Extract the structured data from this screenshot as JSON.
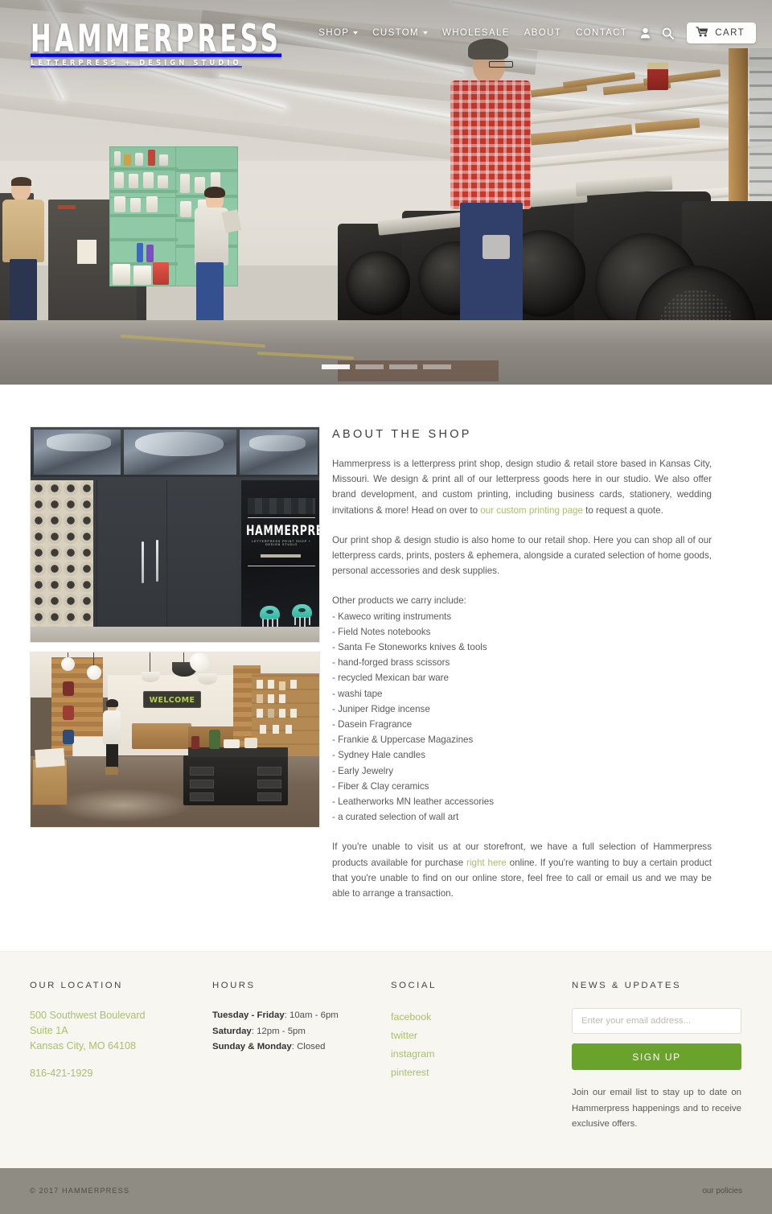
{
  "brand": {
    "logo_main": "HAMMERPRESS",
    "logo_sub": "LETTERPRESS + DESIGN STUDIO"
  },
  "nav": {
    "items": [
      {
        "label": "SHOP",
        "has_dropdown": true
      },
      {
        "label": "CUSTOM",
        "has_dropdown": true
      },
      {
        "label": "WHOLESALE",
        "has_dropdown": false
      },
      {
        "label": "ABOUT",
        "has_dropdown": false
      },
      {
        "label": "CONTACT",
        "has_dropdown": false
      }
    ],
    "account_icon": "user-icon",
    "search_icon": "search-icon",
    "cart_icon": "cart-icon",
    "cart_label": "CART"
  },
  "hero": {
    "alt": "Hammerpress print shop interior with letterpress machines",
    "slide_count": 4,
    "active_slide": 1
  },
  "about": {
    "title": "ABOUT THE SHOP",
    "para1_a": "Hammerpress is a letterpress print shop, design studio & retail store based in Kansas City, Missouri. We design & print all of our letterpress goods here in our studio. We also offer brand development, and custom printing, including business cards, stationery, wedding invitations & more! Head on over to ",
    "para1_link": "our custom printing page",
    "para1_b": " to request a quote.",
    "para2": "Our print shop & design studio is also home to our retail shop. Here you can shop all of our letterpress cards, prints, posters & ephemera, alongside a curated selection of home goods, personal accessories and desk supplies.",
    "list_intro": "Other products we carry include:",
    "products": [
      "- Kaweco writing instruments",
      " - Field Notes notebooks",
      "- Santa Fe Stoneworks knives & tools",
      "- hand-forged brass scissors",
      "- recycled Mexican bar ware",
      "- washi tape",
      "- Juniper Ridge incense",
      "- Dasein Fragrance",
      "- Frankie & Uppercase Magazines",
      "- Sydney Hale candles",
      "- Early Jewelry",
      "- Fiber & Clay ceramics",
      "- Leatherworks MN leather accessories",
      "- a curated selection of wall art"
    ],
    "para3_a": "If you're unable to visit us at our storefront, we have a full selection of Hammerpress products available for purchase ",
    "para3_link": "right here",
    "para3_b": " online. If you're wanting to buy a certain product that you're unable to find on our online store, feel free to call or email us and we may be able to arrange a transaction.",
    "photo_storefront_alt": "Hammerpress storefront with dark doors and teal chairs",
    "photo_interior_alt": "Hammerpress retail shop interior with WELCOME sign",
    "storefront_sign": "HAMMERPRESS",
    "storefront_sign_sub": "LETTERPRESS PRINT SHOP + DESIGN STUDIO",
    "interior_sign": "WELCOME"
  },
  "footer": {
    "location": {
      "heading": "OUR LOCATION",
      "address_line1": "500 Southwest Boulevard",
      "address_line2": "Suite 1A",
      "address_line3": "Kansas City, MO 64108",
      "phone": "816-421-1929"
    },
    "hours": {
      "heading": "HOURS",
      "rows": [
        {
          "days": "Tuesday - Friday",
          "time": ": 10am - 6pm"
        },
        {
          "days": "Saturday",
          "time": ": 12pm - 5pm"
        },
        {
          "days": "Sunday & Monday",
          "time": ": Closed"
        }
      ]
    },
    "social": {
      "heading": "SOCIAL",
      "links": [
        "facebook",
        "twitter",
        "instagram",
        "pinterest"
      ]
    },
    "news": {
      "heading": "NEWS & UPDATES",
      "email_placeholder": "Enter your email address...",
      "email_value": "",
      "button_label": "SIGN UP",
      "blurb": "Join our email list to stay up to date on Hammerpress happenings and to receive exclusive offers."
    }
  },
  "bottom": {
    "copyright": "© 2017 HAMMERPRESS",
    "policies": "our policies"
  },
  "colors": {
    "green_link": "#a9c06a",
    "signup_green": "#6aa32c",
    "footer_bg": "#f7f6f1",
    "bottom_bar": "#8f8c83"
  }
}
